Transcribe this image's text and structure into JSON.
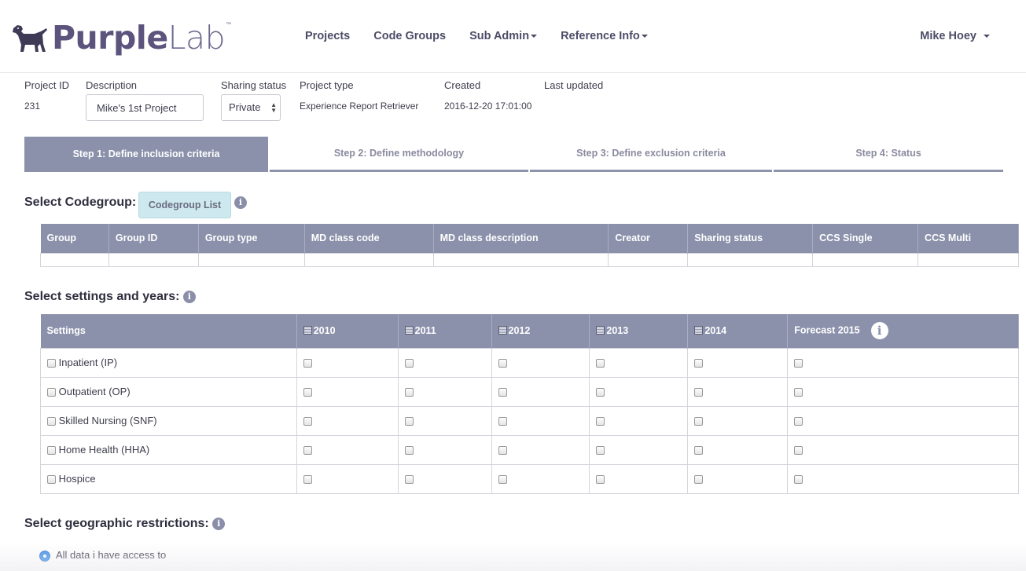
{
  "brand": {
    "name_bold": "Purple",
    "name_light": "Lab",
    "tm": "™"
  },
  "nav": {
    "projects": "Projects",
    "code_groups": "Code Groups",
    "sub_admin": "Sub Admin",
    "reference_info": "Reference Info"
  },
  "user": {
    "name": "Mike Hoey"
  },
  "project": {
    "labels": {
      "id": "Project ID",
      "description": "Description",
      "sharing": "Sharing status",
      "type": "Project type",
      "created": "Created",
      "updated": "Last updated"
    },
    "id": "231",
    "description": "Mike's 1st Project",
    "sharing": "Private",
    "type": "Experience Report Retriever",
    "created": "2016-12-20 17:01:00",
    "updated": ""
  },
  "steps": [
    {
      "label": "Step 1: Define inclusion criteria"
    },
    {
      "label": "Step 2: Define methodology"
    },
    {
      "label": "Step 3: Define exclusion criteria"
    },
    {
      "label": "Step 4: Status"
    }
  ],
  "codegroup": {
    "title": "Select Codegroup:",
    "button": "Codegroup List",
    "columns": [
      "Group",
      "Group ID",
      "Group type",
      "MD class code",
      "MD class description",
      "Creator",
      "Sharing status",
      "CCS Single",
      "CCS Multi"
    ]
  },
  "settings": {
    "title": "Select settings and years:",
    "header": "Settings",
    "years": [
      "2010",
      "2011",
      "2012",
      "2013",
      "2014"
    ],
    "forecast": "Forecast 2015",
    "rows": [
      "Inpatient (IP)",
      "Outpatient (OP)",
      "Skilled Nursing (SNF)",
      "Home Health (HHA)",
      "Hospice"
    ]
  },
  "geo": {
    "title": "Select geographic restrictions:",
    "option_all": "All data i have access to"
  },
  "colors": {
    "accent": "#8b91ab",
    "brand": "#5d547d",
    "button_bg": "#cde8ee",
    "radio": "#3f8fe8"
  }
}
